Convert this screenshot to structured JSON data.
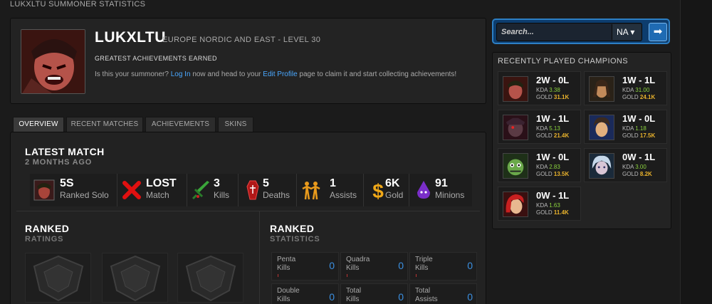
{
  "page_title": "LUKXLTU SUMMONER STATISTICS",
  "profile": {
    "name": "LUKXLTU",
    "region_level": "EUROPE NORDIC AND EAST - LEVEL 30",
    "achievements_title": "GREATEST ACHIEVEMENTS EARNED",
    "claim_prefix": "Is this your summoner?",
    "login_link": "Log In",
    "claim_mid": "now and head to your",
    "edit_link": "Edit Profile",
    "claim_suffix": "page to claim it and start collecting achievements!"
  },
  "tabs": [
    {
      "label": "OVERVIEW"
    },
    {
      "label": "RECENT MATCHES"
    },
    {
      "label": "ACHIEVEMENTS"
    },
    {
      "label": "SKINS"
    }
  ],
  "latest_match": {
    "title": "LATEST MATCH",
    "subtitle": "2 MONTHS AGO",
    "stats": [
      {
        "value": "5S",
        "label": "Ranked Solo",
        "icon": "champion-portrait-icon"
      },
      {
        "value": "LOST",
        "label": "Match",
        "icon": "red-x-icon"
      },
      {
        "value": "3",
        "label": "Kills",
        "icon": "sword-icon"
      },
      {
        "value": "5",
        "label": "Deaths",
        "icon": "coffin-icon"
      },
      {
        "value": "1",
        "label": "Assists",
        "icon": "people-icon"
      },
      {
        "value": "6K",
        "label": "Gold",
        "icon": "dollar-icon"
      },
      {
        "value": "91",
        "label": "Minions",
        "icon": "minion-icon"
      }
    ]
  },
  "ranked_ratings": {
    "title": "RANKED",
    "subtitle": "RATINGS"
  },
  "ranked_stats": {
    "title": "RANKED",
    "subtitle": "STATISTICS",
    "items": [
      {
        "line1": "Penta",
        "line2": "Kills",
        "value": "0"
      },
      {
        "line1": "Quadra",
        "line2": "Kills",
        "value": "0"
      },
      {
        "line1": "Triple",
        "line2": "Kills",
        "value": "0"
      },
      {
        "line1": "Double",
        "line2": "Kills",
        "value": "0"
      },
      {
        "line1": "Total",
        "line2": "Kills",
        "value": "0"
      },
      {
        "line1": "Total",
        "line2": "Assists",
        "value": "0"
      }
    ]
  },
  "search": {
    "placeholder": "Search...",
    "region": "NA ▾",
    "go": "➡"
  },
  "recent": {
    "title": "RECENTLY PLAYED CHAMPIONS",
    "kda_label": "KDA",
    "gold_label": "GOLD",
    "champions": [
      {
        "result": "2W - 0L",
        "kda": "3.38",
        "gold": "31.1K"
      },
      {
        "result": "1W - 1L",
        "kda": "31.00",
        "gold": "24.1K"
      },
      {
        "result": "1W - 1L",
        "kda": "5.13",
        "gold": "21.4K"
      },
      {
        "result": "1W - 0L",
        "kda": "1.18",
        "gold": "17.5K"
      },
      {
        "result": "1W - 0L",
        "kda": "2.83",
        "gold": "13.5K"
      },
      {
        "result": "0W - 1L",
        "kda": "3.00",
        "gold": "8.2K"
      },
      {
        "result": "0W - 1L",
        "kda": "1.63",
        "gold": "11.4K"
      }
    ]
  },
  "colors": {
    "accent_blue": "#3b8fe0",
    "kda_green": "#8bd33e",
    "gold": "#e8b22c",
    "link": "#4aa8ff"
  }
}
